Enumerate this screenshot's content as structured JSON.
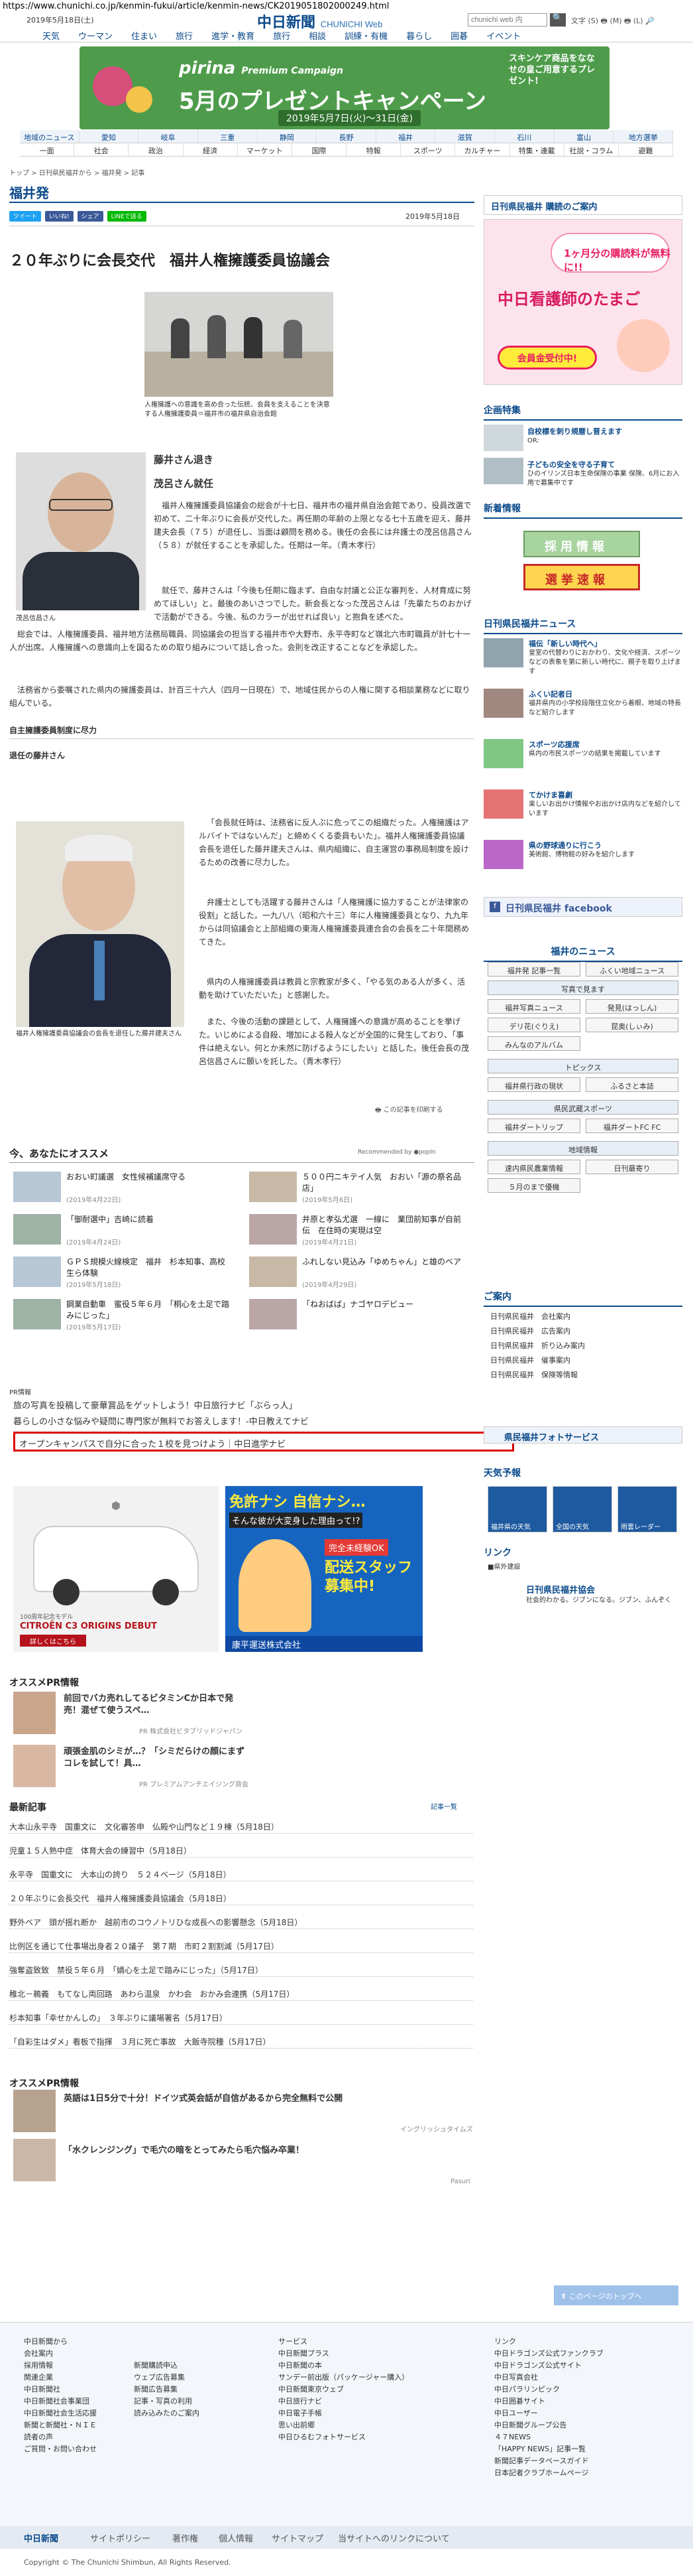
{
  "browser": {
    "url": "https://www.chunichi.co.jp/kenmin-fukui/article/kenmin-news/CK2019051802000249.html"
  },
  "header": {
    "date": "2019年5月18日(土)",
    "logo": "中日新聞",
    "logo_sub": "CHUNICHI Web",
    "search_placeholder": "chunichi web 内",
    "search_btn": "🔍",
    "tools": "文字 (S) 🖶 (M) 🖶 (L) 🔎"
  },
  "gnav": [
    "天気",
    "ウーマン",
    "住まい",
    "旅行",
    "進学・教育",
    "旅行",
    "相談",
    "訓練・有機",
    "暮らし",
    "囲碁",
    "イベント"
  ],
  "banner": {
    "brand": "pirina",
    "sub": "Premium Campaign",
    "main": "5月のプレゼントキャンペーン",
    "period": "2019年5月7日(火)〜31日(金)",
    "side": "スキンケア商品をななせの皇ご用意するプレゼント!"
  },
  "region_nav": {
    "row1": [
      "地域のニュース",
      "愛知",
      "岐阜",
      "三重",
      "静岡",
      "長野",
      "福井",
      "滋賀",
      "石川",
      "富山",
      "地方選挙"
    ],
    "row2": [
      "一面",
      "社会",
      "政治",
      "経済",
      "マーケット",
      "国際",
      "特報",
      "スポーツ",
      "カルチャー",
      "特集・連載",
      "社説・コラム",
      "避難"
    ]
  },
  "breadcrumb": "トップ > 日刊県民福井から > 福井発 > 記事",
  "page_title": "福井発",
  "share": [
    "ツイート",
    "いいね!",
    "シェア",
    "LINEで送る"
  ],
  "article": {
    "date": "2019年5月18日",
    "title": "２０年ぶりに会長交代　福井人権擁護委員協議会",
    "photo1_cap": "人権擁護への意識を高め合った伝統、会員を支えることを決意する人権擁護委員＝福井市の福井県自治会館",
    "sub1": "藤井さん退き",
    "sub2": "茂呂さん就任",
    "portrait1_cap": "茂呂信昌さん",
    "p1": "福井人権擁護委員協議会の総会が十七日、福井市の福井県自治会館であり、役員改選で初めて、二十年ぶりに会長が交代した。再任期の年齢の上限となる七十五歳を迎え、藤井建夫会長（７５）が退任し、当面は顧問を務める。後任の会長には弁護士の茂呂信昌さん（５８）が就任することを承認した。任期は一年。（青木孝行）",
    "p2": "就任で、藤井さんは「今後も任期に臨まず、自由な討議と公正な審判を、人材育成に努めてほしい」と。最後のあいさつでした。新会長となった茂呂さんは「先輩たちのおかげで活動ができる。今後、私のカラーが出せれば良い」と抱負を述べた。",
    "p3": "総会では、人権擁護委員、福井地方法務局職員、同協議会の担当する福井市や大野市、永平寺町など嶺北六市町職員が計七十一人が出席。人権擁護への意識向上を図るための取り組みについて話し合った。会則を改正することなどを承認した。",
    "p4": "法務省から委嘱された県内の擁護委員は、計百三十六人（四月一日現在）で、地域住民からの人権に関する相談業務などに取り組んでいる。",
    "h_box": "自主擁護委員制度に尽力",
    "h_prev": "退任の藤井さん",
    "portrait2_cap": "福井人権擁護委員協議会の会長を退任した藤井建夫さん",
    "q1": "「会長就任時は、法務省に反人ぶに危ってこの組織だった。人権擁護はアルバイトではないんだ」と締めくくる委員もいた」。福井人権擁護委員協議会長を退任した藤井建夫さんは、県内組織に、自主運営の事務局制度を設けるための改善に尽力した。",
    "q2": "弁護士としても活躍する藤井さんは「人権擁護に協力することが法律家の役割」と話した。一九八八（昭和六十三）年に人権擁護委員となり、九九年からは同協議会と上部組織の東海人権擁護委員連合会の会長を二十年間務めてきた。",
    "q3": "県内の人権擁護委員は教員と宗教家が多く、「やる気のある人が多く、活動を助けていただいた」と感謝した。",
    "q4": "また、今後の活動の課題として、人権擁護への意識が高めることを挙げた。いじめによる自殺、増加による殺人などが全国的に発生しており、「事件は絶えない。何とか未然に防げるようにしたい」と話した。後任会長の茂呂信昌さんに願いを託した。（青木孝行）",
    "print": "この記事を印刷する"
  },
  "recommend": {
    "title": "今、あなたにオススメ",
    "by": "Recommended by ●popIn",
    "items": [
      {
        "t": "おおい町議選　女性候補議席守る",
        "d": "(2019年4月22日)"
      },
      {
        "t": "５００円ニキテイ人気　おおい「源の祭名品店」",
        "d": "(2019年5月6日)"
      },
      {
        "t": "「御耐選中」吉崎に読着",
        "d": "(2019年4月24日)"
      },
      {
        "t": "井原と孝弘尤選　一線に　業団前知事が自前伝　在住時の実現は空",
        "d": "(2019年4月21日)"
      },
      {
        "t": "ＧＰＳ規模火線検定　福井　杉本知事、高校生ら体験",
        "d": "(2019年5月18日)"
      },
      {
        "t": "ふれしない見込み「ゆめちゃん」と雄のベア",
        "d": "(2019年4月29日)"
      },
      {
        "t": "鋼業自動車　蜜役５年６月　「桐心を土足で踏みにじった」",
        "d": "(2019年5月17日)"
      },
      {
        "t": "「ねおばば」ナゴヤロデビュー",
        "d": ""
      }
    ]
  },
  "pr": {
    "label": "PR情報",
    "items": [
      "旅の写真を投稿して豪華賞品をゲットしよう！中日旅行ナビ「ぶらっ人」",
      "暮らしの小さな悩みや疑問に専門家が無料でお答えします！-中日教えてナビ",
      "オープンキャンパスで自分に合った１校を見つけよう｜中日進学ナビ"
    ]
  },
  "ads": {
    "ad1_line1": "100周年記念モデル",
    "ad1_line2": "CITROËN C3 ORIGINS DEBUT",
    "ad1_btn": "詳しくはこちら",
    "ad2_line1": "免許ナシ 自信ナシ…",
    "ad2_line2": "そんな彼が大変身した理由って!?",
    "ad2_line3": "完全未経験OK",
    "ad2_line4": "配送スタッフ募集中!",
    "ad2_company": "康平運送株式会社"
  },
  "pr_osusume": {
    "title": "オススメPR情報",
    "items": [
      {
        "t": "前回でバカ売れしてるビタミンCか日本で発売！混ぜて使うスペ…",
        "s": "PR 株式会社ビタブリッドジャパン"
      },
      {
        "t": "頑張金肌のシミが…？「シミだらけの顔にまずコレを試して！具…",
        "s": "PR プレミアムアンチエイジング商会"
      }
    ]
  },
  "latest": {
    "title": "最新記事",
    "more": "記事一覧",
    "items": [
      "大本山永平寺　国重文に　文化審答申　仏殿や山門など１９棟（5月18日）",
      "児童１５人熟中症　体育大会の練習中（5月18日）",
      "永平寺　国重文に　大本山の誇り　５２４ベージ（5月18日）",
      "２０年ぶりに会長交代　福井人権擁護委員協議会（5月18日）",
      "野外ベア　頭が揺れ断か　越前市のコウノトリひな成長への影響懸念（5月18日）",
      "比例区を通じて仕事場出身者２０議子　第７期　市町２割割減（5月17日）",
      "強奪盗致致　禁役５年６月　「嫡心を土足で踏みにじった」（5月17日）",
      "稚北－鵜義　もてなし両回路　あわら温泉　かわ会　おかみ会連携（5月17日）",
      "杉本知事「幸せかんしの」　３年ぶりに議場署名（5月17日）",
      "「自彩生はダメ」看板で指揮　３月に死亡事故　大飯寺院種（5月17日）"
    ]
  },
  "pr2": {
    "title": "オススメPR情報",
    "items": [
      {
        "t": "英語は1日5分で十分！ドイツ式英会話が自信があるから完全無料で公開",
        "s": "イングリッシュタイムズ"
      },
      {
        "t": "「水クレンジング」で毛穴の暗をとってみたら毛穴悩み卒業！",
        "s": "Pasuri"
      }
    ]
  },
  "sidebar": {
    "subscribe": "日刊県民福井 購読のご案内",
    "bnr2_top": "1ヶ月分の購読料が無料に!!",
    "bnr2_main": "中日看護師のたまご",
    "bnr2_sub": "会員金受付中!",
    "kikaku": "企画特集",
    "k1_t": "自校標を刺り規暦し晋えます",
    "k1_s": "OR:",
    "k2_t": "子どもの安全を守る子育て",
    "k2_s": "ひのイリンズ日本生命保険の事業 保険、6月にお入用で募集中です",
    "shinchaku": "新着情報",
    "saiyo": "採用情報",
    "senkyo": "選挙速報",
    "fukui_shinbun": "日刊県民福井ニュース",
    "s1_t": "福伝「新しい時代へ」",
    "s1_s": "皇室の代替わりにおかわり、文化や経済、スポーツなどの表象を第に新しい時代に、親子を取り上げます",
    "s2_t": "ふくい記者日",
    "s2_s": "福井県内の小学校段階住立化から着眼、地域の特長など紹介します",
    "s3_t": "スポーツ応援席",
    "s3_s": "県内の市民スポーツの結果を掲載しています",
    "s4_t": "てかけま喜劇",
    "s4_s": "楽しいお出かけ情報やお出かけ店内などを紹介しています",
    "s5_t": "県の野球通りに行こう",
    "s5_s": "美術館、博物館の好みを紹介します",
    "fb": "日刊県民福井 facebook",
    "fn": "福井のニュース",
    "fn_btn": [
      "福井発 記事一覧",
      "ふくい地域ニュース"
    ],
    "photo": "写真で見ます",
    "ph_btn": [
      "福井写真ニュース",
      "発見(はっしん)",
      "デリ花(ぐりえ)",
      "昆奥(しぃみ)",
      "みんなのアルバム"
    ],
    "topics": "トピックス",
    "tp_btn": [
      "福井県行政の現状",
      "ふるさと本誌"
    ],
    "kensports": "県民武蔵スポーツ",
    "ks_btn": [
      "福井ダートリップ",
      "福井ダートFC FC"
    ],
    "chiiki": "地域情報",
    "ch_btn": [
      "速内県民農業情報",
      "日刊最寄り"
    ],
    "ch3": "５月のまで優機",
    "goan": "ご案内",
    "goan_items": [
      "日刊県民福井　会社案内",
      "日刊県民福井　広告案内",
      "日刊県民福井　折り込み案内",
      "日刊県民福井　催事案内",
      "日刊県民福井　保険等情報"
    ],
    "photoservice": "県民福井フォトサービス",
    "weather": "天気予報",
    "wx": [
      "福井県の天気",
      "全国の天気",
      "雨雲レーダー"
    ],
    "link": "リンク",
    "link_item": "■県外建設",
    "kyokai": "日刊県民福井協会",
    "kyokai_s": "社会的わかる。ジブンになる。ジブン、ふんぞく"
  },
  "top_link": "このページのトップへ",
  "footer": {
    "c1": [
      "中日新聞から",
      "会社案内",
      "採用情報",
      "関連企業",
      "中日新聞社",
      "中日新聞社会事業団",
      "中日新聞社会生活応援",
      "新聞と新聞社・ＮＩＥ",
      "読者の声",
      "ご質問・お問い合わせ"
    ],
    "c2": [
      "新聞購読申込",
      "ウェブ広告募集",
      "新聞広告募集",
      "記事・写真の利用",
      "読み込みたのご案内"
    ],
    "c3": [
      "サービス",
      "中日新聞プラス",
      "中日新聞の本",
      "サンデー前出版（パッケージャー購入）",
      "中日新聞東京ウェブ",
      "中日旅行ナビ",
      "中日電子手帳",
      "思い出前郷",
      "中日ひるむフォトサービス"
    ],
    "c4": [
      "リンク",
      "中日ドラゴンズ公式ファンクラブ",
      "中日ドラゴンズ公式サイト",
      "中日写真会社",
      "中日パラリンピック",
      "中日囲碁サイト",
      "中日ユーザー",
      "中日新聞グループ公告",
      "４７NEWS",
      "「HAPPY NEWS」記事一覧",
      "新聞記事データベースガイド",
      "日本記者クラブホームページ"
    ],
    "bar": [
      "中日新聞",
      "サイトポリシー",
      "著作権",
      "個人情報",
      "サイトマップ",
      "当サイトへのリンクについて"
    ],
    "copy": "Copyright © The Chunichi Shimbun, All Rights Reserved."
  }
}
